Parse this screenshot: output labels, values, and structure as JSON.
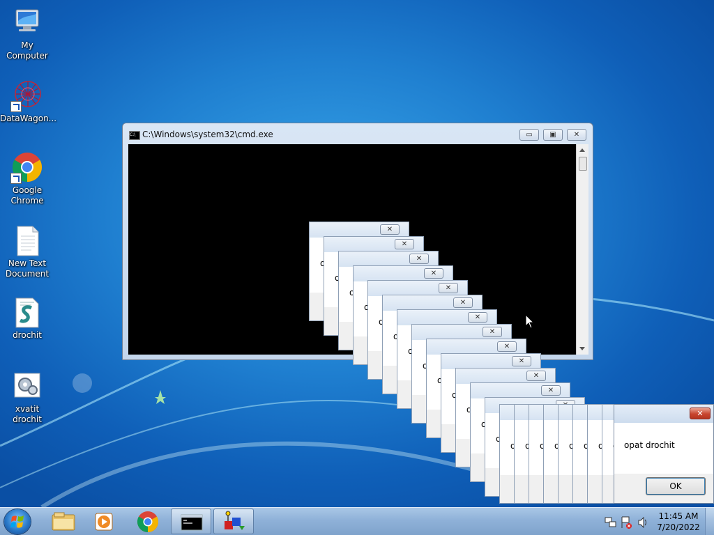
{
  "desktop": {
    "icons": [
      {
        "label": "My Computer",
        "icon": "computer-icon"
      },
      {
        "label": "DataWagon...",
        "icon": "datawagon-icon"
      },
      {
        "label": "Google Chrome",
        "icon": "chrome-icon"
      },
      {
        "label": "New Text Document",
        "icon": "text-document-icon"
      },
      {
        "label": "drochit",
        "icon": "script-icon"
      },
      {
        "label": "xvatit drochit",
        "icon": "settings-script-icon"
      }
    ]
  },
  "cmd_window": {
    "title": "C:\\Windows\\system32\\cmd.exe",
    "minimize": "▭",
    "maximize": "▣",
    "close": "✕",
    "icon_text": "C:\\"
  },
  "dialogs": {
    "partial_text": "o",
    "close": "✕",
    "count": 23
  },
  "main_dialog": {
    "message": "opat drochit",
    "ok_label": "OK",
    "close": "✕"
  },
  "taskbar": {
    "pinned": [
      "start-orb",
      "explorer-icon",
      "media-player-icon",
      "chrome-icon",
      "cmd-icon",
      "script-host-icon"
    ],
    "clock": {
      "time": "11:45 AM",
      "date": "7/20/2022"
    },
    "tray_icons": [
      "network-icon",
      "action-center-icon",
      "volume-icon"
    ]
  },
  "colors": {
    "accent": "#1f7fd0",
    "close_red": "#c8452e"
  }
}
